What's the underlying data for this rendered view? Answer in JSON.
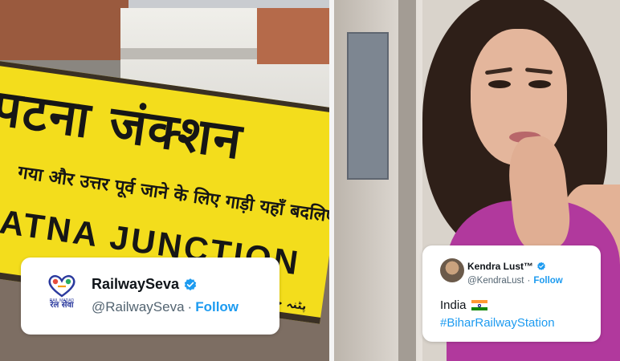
{
  "scene_left": {
    "sign_hindi": "पटना जंक्शन",
    "sign_hindi_sub": "गया और उत्तर पूर्व जाने के लिए गाड़ी यहाँ बदलिए",
    "sign_english": "PATNA JUNCTION",
    "sign_urdu": "پٹنہ جنکشن"
  },
  "tweet_left": {
    "logo_text": "रेल सेवा",
    "logo_small_text": "RAIL MADAD",
    "display_name": "RailwaySeva",
    "handle": "@RailwaySeva",
    "separator": "·",
    "follow_label": "Follow",
    "verified_icon": "verified-badge-icon"
  },
  "tweet_right": {
    "display_name": "Kendra Lust™",
    "handle": "@KendraLust",
    "separator": "·",
    "follow_label": "Follow",
    "text": "India",
    "hashtag": "#BiharRailwayStation",
    "verified_icon": "verified-badge-icon",
    "flag_icon": "india-flag-emoji"
  },
  "colors": {
    "follow_blue": "#1d9bf0",
    "sign_yellow": "#f3dd1c",
    "name_black": "#0f1419",
    "handle_gray": "#536471"
  }
}
